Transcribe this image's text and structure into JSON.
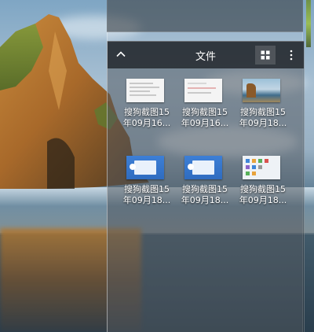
{
  "fence": {
    "title": "文件"
  },
  "files": [
    {
      "label": "搜狗截图15\n年09月16...",
      "thumb": "doc-white"
    },
    {
      "label": "搜狗截图15\n年09月16...",
      "thumb": "doc-white-red"
    },
    {
      "label": "搜狗截图15\n年09月18...",
      "thumb": "beach-photo"
    },
    {
      "label": "搜狗截图15\n年09月18...",
      "thumb": "blue-app"
    },
    {
      "label": "搜狗截图15\n年09月18...",
      "thumb": "blue-app"
    },
    {
      "label": "搜狗截图15\n年09月18...",
      "thumb": "desktop-icons"
    }
  ],
  "icons": {
    "collapse": "chevron-up-icon",
    "view": "grid-view-icon",
    "more": "more-vertical-icon"
  },
  "colors": {
    "title_bar": "#1e2126",
    "active_view_button": "#5a5f64",
    "label_text": "#ffffff"
  }
}
